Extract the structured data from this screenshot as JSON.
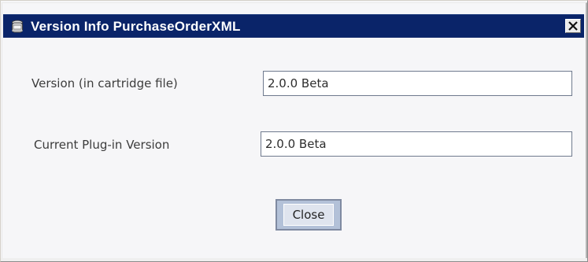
{
  "window": {
    "title": "Version Info PurchaseOrderXML"
  },
  "form": {
    "cartridge_label": "Version (in cartridge file)",
    "cartridge_value": "2.0.0 Beta",
    "plugin_label": "Current Plug-in Version",
    "plugin_value": "2.0.0 Beta"
  },
  "actions": {
    "close_label": "Close"
  },
  "icons": {
    "title": "jar-icon",
    "close": "close-x-icon"
  },
  "colors": {
    "titlebar": "#0a2469",
    "button_border": "#7f8aa1",
    "button_fill": "#dfe4ee"
  }
}
